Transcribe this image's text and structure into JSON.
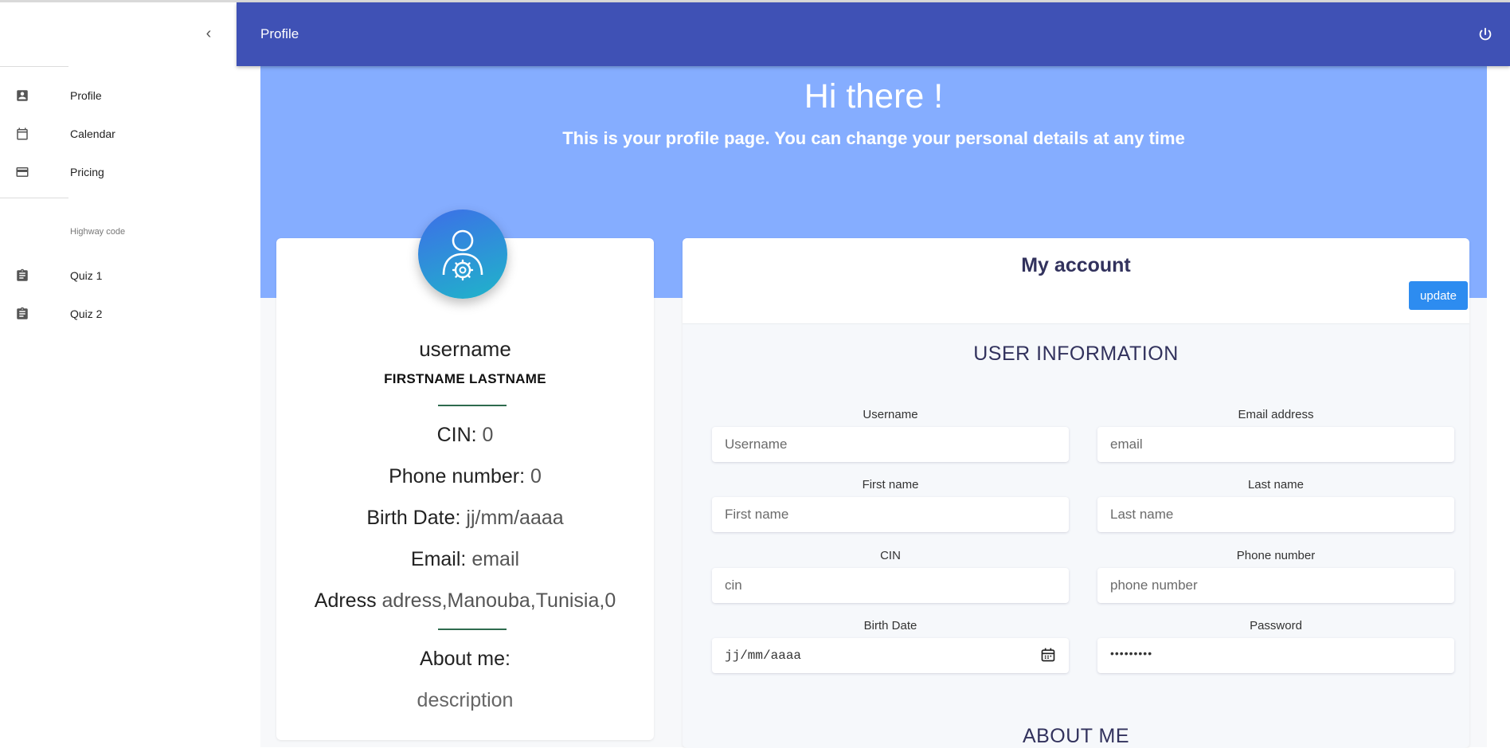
{
  "header": {
    "title": "Profile"
  },
  "sidebar": {
    "items": [
      {
        "label": "Profile",
        "icon": "account-box-icon"
      },
      {
        "label": "Calendar",
        "icon": "calendar-icon"
      },
      {
        "label": "Pricing",
        "icon": "credit-card-icon"
      }
    ],
    "section_label": "Highway code",
    "quiz_items": [
      {
        "label": "Quiz 1",
        "icon": "clipboard-icon"
      },
      {
        "label": "Quiz 2",
        "icon": "clipboard-icon"
      }
    ]
  },
  "hero": {
    "title": "Hi there !",
    "subtitle": "This is your profile page. You can change your personal details at any time"
  },
  "profile_card": {
    "username": "username",
    "fullname": "FIRSTNAME LASTNAME",
    "cin_label": "CIN:",
    "cin_value": "0",
    "phone_label": "Phone number:",
    "phone_value": "0",
    "birth_label": "Birth Date:",
    "birth_value": "jj/mm/aaaa",
    "email_label": "Email:",
    "email_value": "email",
    "address_label": "Adress",
    "address_value": "adress,Manouba,Tunisia,0",
    "about_label": "About me:",
    "description": "description"
  },
  "account": {
    "title": "My account",
    "update_label": "update",
    "section_user": "USER INFORMATION",
    "section_about": "ABOUT ME",
    "fields": {
      "username": {
        "label": "Username",
        "placeholder": "Username"
      },
      "email": {
        "label": "Email address",
        "placeholder": "email"
      },
      "first_name": {
        "label": "First name",
        "placeholder": "First name"
      },
      "last_name": {
        "label": "Last name",
        "placeholder": "Last name"
      },
      "cin": {
        "label": "CIN",
        "placeholder": "cin"
      },
      "phone": {
        "label": "Phone number",
        "placeholder": "phone number"
      },
      "birth_date": {
        "label": "Birth Date",
        "value": "jj/mm/aaaa"
      },
      "password": {
        "label": "Password",
        "value": "•••••••••"
      }
    }
  },
  "colors": {
    "header_bg": "#3f51b5",
    "hero_bg": "#85adff",
    "update_button": "#2d8cf0",
    "separator": "#2e6b4e"
  }
}
